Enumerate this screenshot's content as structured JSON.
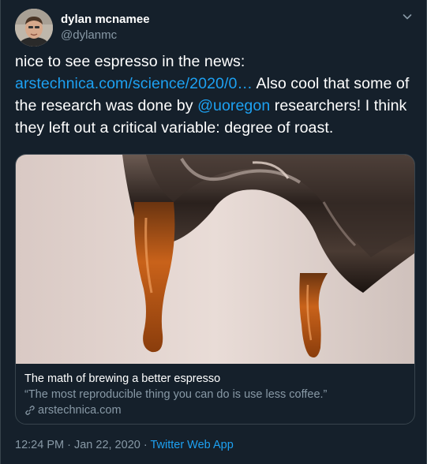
{
  "author": {
    "display_name": "dylan mcnamee",
    "handle": "@dylanmc"
  },
  "tweet": {
    "text_1": "nice to see espresso in the news: ",
    "link_url": "arstechnica.com/science/2020/0…",
    "text_2": " Also cool that some of the research was done by ",
    "mention": "@uoregon",
    "text_3": " researchers! I think they left out a critical variable: degree of roast."
  },
  "card": {
    "title": "The math of brewing a better espresso",
    "description": "“The most reproducible thing you can do is use less coffee.”",
    "domain": "arstechnica.com"
  },
  "footer": {
    "time": "12:24 PM",
    "separator_1": " · ",
    "date": "Jan 22, 2020",
    "separator_2": " · ",
    "source": "Twitter Web App"
  },
  "icons": {
    "menu": "chevron-down-icon",
    "card_link": "link-icon"
  },
  "colors": {
    "background": "#15202b",
    "accent": "#1da1f2",
    "secondary_text": "#8899a6",
    "border": "#38444d"
  }
}
